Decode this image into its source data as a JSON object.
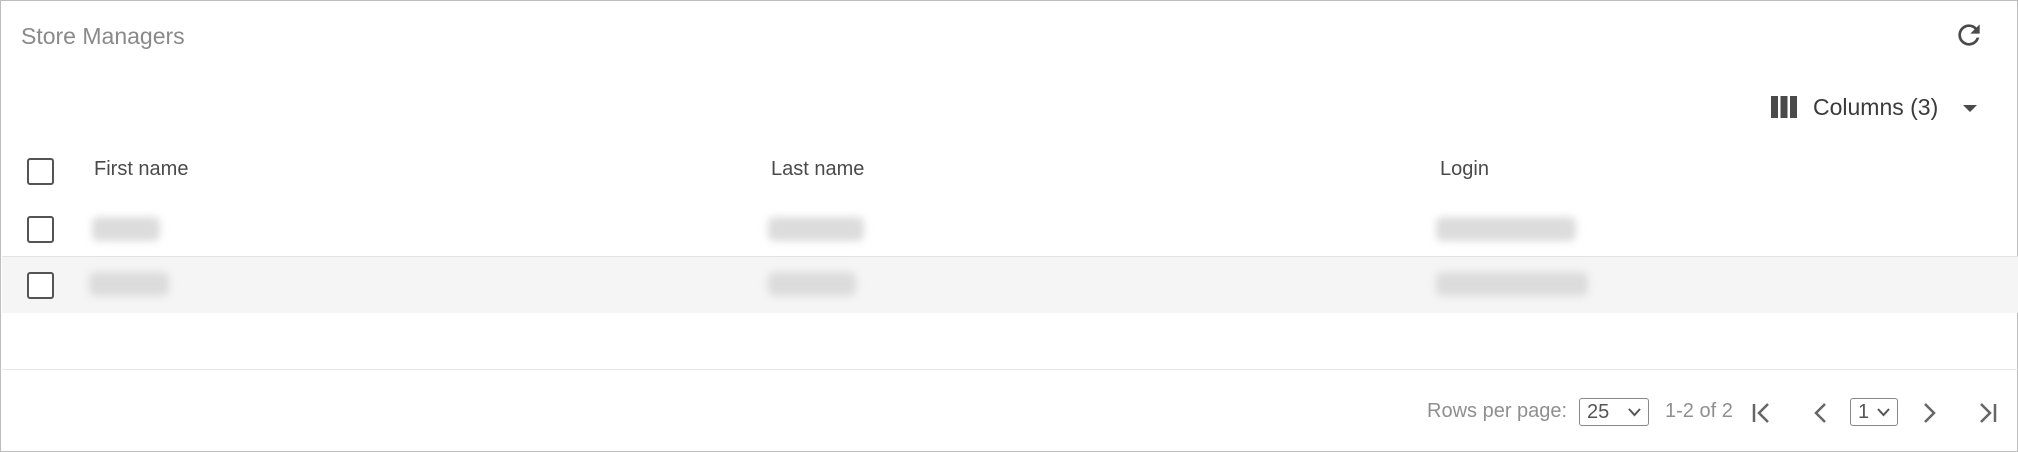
{
  "title": "Store Managers",
  "toolbar": {
    "refresh_icon": "refresh-icon",
    "columns_icon": "view-columns-icon",
    "columns_label": "Columns (3)",
    "columns_caret_icon": "caret-down-icon"
  },
  "table": {
    "headers": [
      "First name",
      "Last name",
      "Login"
    ],
    "rows": [
      {
        "first_name": "[redacted]",
        "last_name": "[redacted]",
        "login": "[redacted]",
        "selected": false
      },
      {
        "first_name": "[redacted]",
        "last_name": "[redacted]",
        "login": "[redacted]",
        "selected": false
      }
    ]
  },
  "pagination": {
    "rows_per_page_label": "Rows per page:",
    "rows_per_page_value": "25",
    "range_text": "1-2 of 2",
    "page_value": "1",
    "icons": [
      "first-page-icon",
      "previous-page-icon",
      "next-page-icon",
      "last-page-icon"
    ]
  },
  "colors": {
    "border": "#bdbdbd",
    "row_alt": "#f5f5f5",
    "icon": "#555555",
    "muted_text": "#8f8f8f"
  }
}
